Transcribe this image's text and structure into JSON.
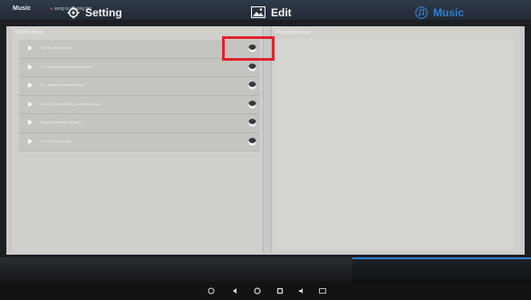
{
  "titlebar": {
    "app": "Music",
    "subtitle": "song is playing list"
  },
  "left_panel": {
    "title": "Playlist Music"
  },
  "right_panel": {
    "title": "Playing list music"
  },
  "tracks": [
    {
      "name": "001 Something text"
    },
    {
      "name": "01 I just lost think songs list.mp3"
    },
    {
      "name": "01 - funker's sound list.mp3"
    },
    {
      "name": "03 and_the last time_yaras mait.mp3"
    },
    {
      "name": "04 good evening list.mp3"
    },
    {
      "name": "06 Love Story.mp3"
    }
  ],
  "tabs": {
    "setting": "Setting",
    "edit": "Edit",
    "music": "Music"
  },
  "colors": {
    "accent": "#2f7fd4",
    "highlight": "#e0242c"
  }
}
